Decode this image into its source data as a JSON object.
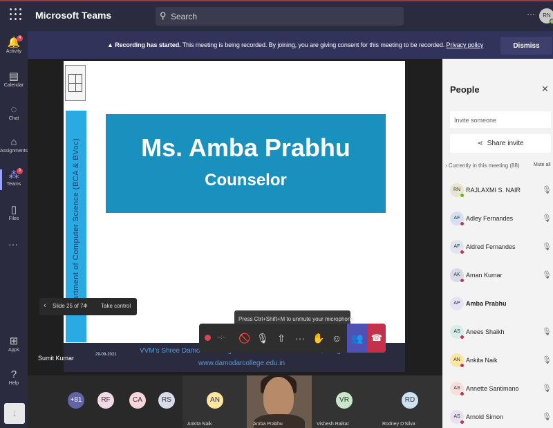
{
  "app": {
    "name": "Microsoft Teams"
  },
  "search": {
    "placeholder": "Search",
    "icon": "search-icon"
  },
  "topbar": {
    "more": "···",
    "avatar_initials": "RN"
  },
  "rail": {
    "items": [
      {
        "label": "Activity",
        "glyph": "🔔",
        "badge": "4"
      },
      {
        "label": "Calendar",
        "glyph": "▤",
        "badge": ""
      },
      {
        "label": "Chat",
        "glyph": "◌",
        "badge": ""
      },
      {
        "label": "Assignments",
        "glyph": "⌂",
        "badge": ""
      },
      {
        "label": "Teams",
        "glyph": "⁂",
        "badge": "9"
      },
      {
        "label": "Files",
        "glyph": "▯",
        "badge": ""
      }
    ],
    "more": "···",
    "apps": {
      "label": "Apps",
      "glyph": "⊞"
    },
    "help": {
      "label": "Help",
      "glyph": "?"
    },
    "download_glyph": "↓"
  },
  "banner": {
    "bold": "Recording has started.",
    "text": " This meeting is being recorded. By joining, you are giving consent for this meeting to be recorded. ",
    "link": "Privacy policy",
    "dismiss": "Dismiss",
    "warn_glyph": "▲"
  },
  "slide": {
    "vertical_text": "Department of Computer Science (BCA & BVoc)",
    "name": "Ms. Amba Prabhu",
    "role": "Counselor",
    "footer_date": "29-09-2021",
    "footer_college": "VVM's Shree Damodar College of Commerce & Economics, Margao - Goa",
    "footer_url": "www.damodarcollege.edu.in"
  },
  "slide_nav": {
    "prev": "‹",
    "counter": "Slide 25 of 74",
    "next": "›",
    "take_control": "Take control"
  },
  "tooltip": "Press Ctrl+Shift+M to unmute your microphone.",
  "controls": {
    "rec_time": "--:--",
    "camera": "🚫",
    "mic": "🎙",
    "share": "⇧",
    "more": "···",
    "raise_hand": "✋",
    "chat": "☺",
    "people": "👥",
    "leave": "☎"
  },
  "presenter_label": "Sumit Kumar",
  "gallery": {
    "avatars": [
      {
        "initials": "+81",
        "bg": "#6264a7",
        "fg": "#ffffff"
      },
      {
        "initials": "RF",
        "bg": "#f2d9e6",
        "fg": "#333333"
      },
      {
        "initials": "CA",
        "bg": "#f7d5d9",
        "fg": "#333333"
      },
      {
        "initials": "RS",
        "bg": "#d8dce8",
        "fg": "#333333"
      },
      {
        "initials": "AN",
        "bg": "#fde6a2",
        "fg": "#333333"
      },
      {
        "initials": "VR",
        "bg": "#c8e6c9",
        "fg": "#333333"
      },
      {
        "initials": "RD",
        "bg": "#cde3f2",
        "fg": "#333333"
      }
    ],
    "names": [
      "Ankita Naik",
      "Amba Prabhu",
      "Vishesh Raikar",
      "Rodney D'Silva"
    ]
  },
  "people": {
    "title": "People",
    "close": "✕",
    "invite_placeholder": "Invite someone",
    "share_invite": "Share invite",
    "share_glyph": "⋖",
    "section": "Currently in this meeting (88)",
    "mute_all": "Mute all",
    "mic_off_glyph": "🎙",
    "list": [
      {
        "initials": "RN",
        "name": "RAJLAXMI S. NAIR",
        "bg": "#e6e6d0",
        "status": "green"
      },
      {
        "initials": "AF",
        "name": "Adley Fernandes",
        "bg": "#d6e0f5",
        "status": "red"
      },
      {
        "initials": "AF",
        "name": "Aldred Fernandes",
        "bg": "#dfe5ee",
        "status": "red"
      },
      {
        "initials": "AK",
        "name": "Aman Kumar",
        "bg": "#d6dbe8",
        "status": "red"
      },
      {
        "initials": "AP",
        "name": "Amba Prabhu",
        "bg": "#e3e4f5",
        "status": "none"
      },
      {
        "initials": "AS",
        "name": "Anees Shaikh",
        "bg": "#d6ece8",
        "status": "red"
      },
      {
        "initials": "AN",
        "name": "Ankita Naik",
        "bg": "#fde6a2",
        "status": "red"
      },
      {
        "initials": "AS",
        "name": "Annette Santimano",
        "bg": "#f5e0dc",
        "status": "red"
      },
      {
        "initials": "AS",
        "name": "Arnold Simon",
        "bg": "#e8e0f0",
        "status": "red"
      }
    ]
  }
}
